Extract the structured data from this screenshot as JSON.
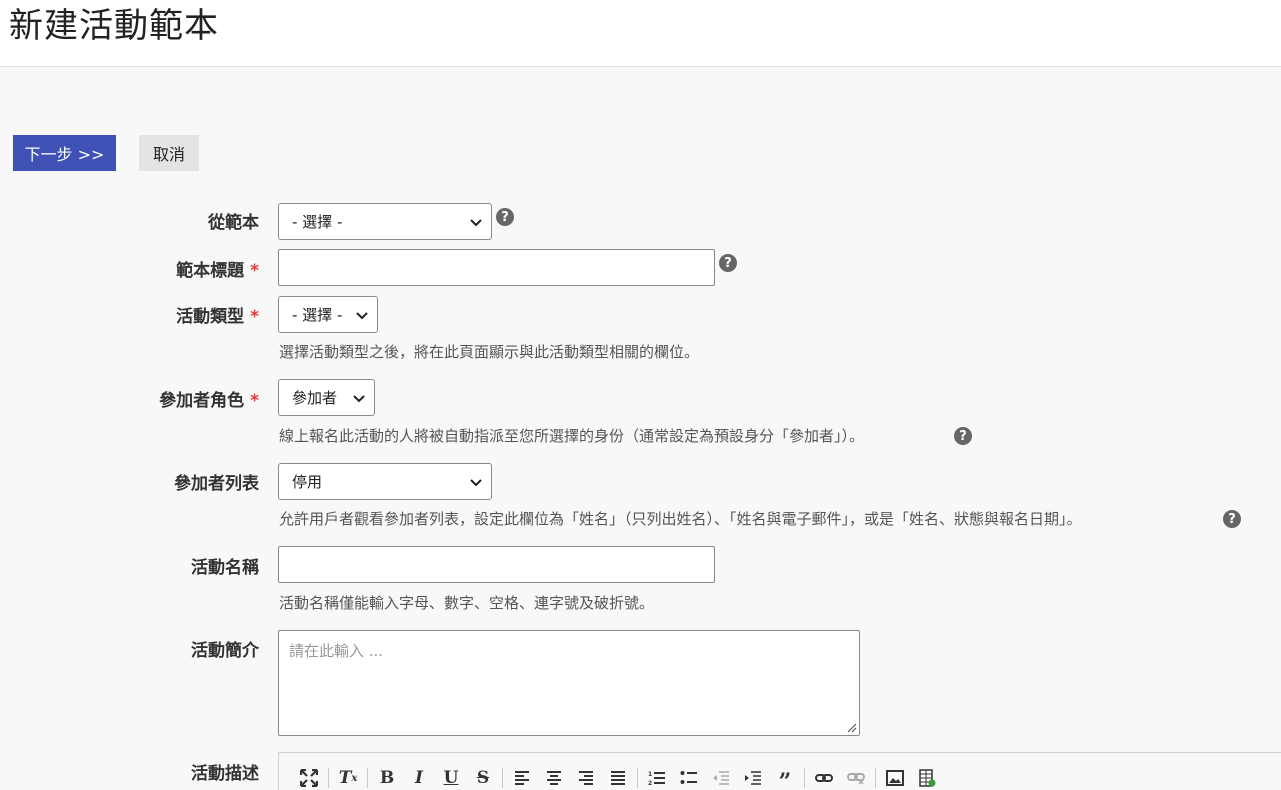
{
  "page": {
    "title": "新建活動範本"
  },
  "actions": {
    "next_label": "下一步 >>",
    "cancel_label": "取消"
  },
  "form": {
    "from_template": {
      "label": "從範本",
      "value": "- 選擇 -",
      "options": [
        "- 選擇 -"
      ]
    },
    "template_title": {
      "label": "範本標題",
      "required_mark": "*",
      "value": ""
    },
    "event_type": {
      "label": "活動類型",
      "required_mark": "*",
      "value": "- 選擇 -",
      "help_text": "選擇活動類型之後，將在此頁面顯示與此活動類型相關的欄位。"
    },
    "participant_role": {
      "label": "參加者角色",
      "required_mark": "*",
      "value": "參加者",
      "help_text": "線上報名此活動的人將被自動指派至您所選擇的身份（通常設定為預設身分「參加者」）。"
    },
    "participant_list": {
      "label": "參加者列表",
      "value": "停用",
      "help_text": "允許用戶者觀看參加者列表，設定此欄位為「姓名」（只列出姓名）、「姓名與電子郵件」，或是「姓名、狀態與報名日期」。"
    },
    "event_name": {
      "label": "活動名稱",
      "value": "",
      "help_text": "活動名稱僅能輸入字母、數字、空格、連字號及破折號。"
    },
    "event_summary": {
      "label": "活動簡介",
      "placeholder": "請在此輸入 ..."
    },
    "event_description": {
      "label": "活動描述"
    }
  },
  "editor_toolbar": {
    "buttons": [
      "maximize-icon",
      "remove-format-icon",
      "bold-icon",
      "italic-icon",
      "underline-icon",
      "strikethrough-icon",
      "align-left-icon",
      "align-center-icon",
      "align-right-icon",
      "align-justify-icon",
      "numbered-list-icon",
      "bulleted-list-icon",
      "outdent-icon",
      "indent-icon",
      "blockquote-icon",
      "link-icon",
      "unlink-icon",
      "image-icon",
      "table-image-icon"
    ]
  },
  "colors": {
    "primary": "#3f51b5",
    "required": "#e03a3a",
    "help_icon": "#666666"
  }
}
